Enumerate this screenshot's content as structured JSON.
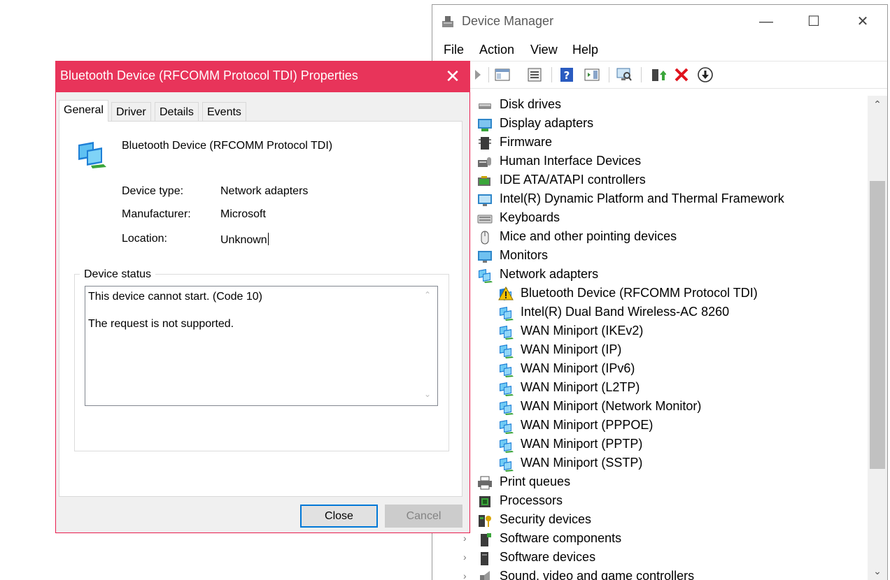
{
  "device_manager": {
    "title": "Device Manager",
    "window_buttons": {
      "minimize": "—",
      "maximize": "☐",
      "close": "✕"
    },
    "menu": [
      "File",
      "Action",
      "View",
      "Help"
    ],
    "toolbar": [
      "back-icon",
      "show-hide-console-tree-icon",
      "properties-icon",
      "help-icon",
      "action-pane-icon",
      "scan-for-hardware-changes-icon",
      "update-driver-icon",
      "uninstall-device-icon",
      "disable-device-icon"
    ],
    "tree": [
      {
        "label": "Disk drives",
        "icon": "disk-drive-icon",
        "level": 0
      },
      {
        "label": "Display adapters",
        "icon": "display-adapter-icon",
        "level": 0
      },
      {
        "label": "Firmware",
        "icon": "firmware-icon",
        "level": 0
      },
      {
        "label": "Human Interface Devices",
        "icon": "hid-icon",
        "level": 0
      },
      {
        "label": "IDE ATA/ATAPI controllers",
        "icon": "ide-controller-icon",
        "level": 0
      },
      {
        "label": "Intel(R) Dynamic Platform and Thermal Framework",
        "icon": "intel-platform-icon",
        "level": 0
      },
      {
        "label": "Keyboards",
        "icon": "keyboard-icon",
        "level": 0
      },
      {
        "label": "Mice and other pointing devices",
        "icon": "mouse-icon",
        "level": 0
      },
      {
        "label": "Monitors",
        "icon": "monitor-icon",
        "level": 0
      },
      {
        "label": "Network adapters",
        "icon": "network-adapter-icon",
        "level": 0
      },
      {
        "label": "Bluetooth Device (RFCOMM Protocol TDI)",
        "icon": "network-warning-icon",
        "level": 1
      },
      {
        "label": "Intel(R) Dual Band Wireless-AC 8260",
        "icon": "network-adapter-icon",
        "level": 1
      },
      {
        "label": "WAN Miniport (IKEv2)",
        "icon": "network-adapter-icon",
        "level": 1
      },
      {
        "label": "WAN Miniport (IP)",
        "icon": "network-adapter-icon",
        "level": 1
      },
      {
        "label": "WAN Miniport (IPv6)",
        "icon": "network-adapter-icon",
        "level": 1
      },
      {
        "label": "WAN Miniport (L2TP)",
        "icon": "network-adapter-icon",
        "level": 1
      },
      {
        "label": "WAN Miniport (Network Monitor)",
        "icon": "network-adapter-icon",
        "level": 1
      },
      {
        "label": "WAN Miniport (PPPOE)",
        "icon": "network-adapter-icon",
        "level": 1
      },
      {
        "label": "WAN Miniport (PPTP)",
        "icon": "network-adapter-icon",
        "level": 1
      },
      {
        "label": "WAN Miniport (SSTP)",
        "icon": "network-adapter-icon",
        "level": 1
      },
      {
        "label": "Print queues",
        "icon": "printer-icon",
        "level": 0
      },
      {
        "label": "Processors",
        "icon": "processor-icon",
        "level": 0
      },
      {
        "label": "Security devices",
        "icon": "security-device-icon",
        "level": 0
      },
      {
        "label": "Software components",
        "icon": "software-component-icon",
        "level": 0,
        "expander": "›"
      },
      {
        "label": "Software devices",
        "icon": "software-device-icon",
        "level": 0,
        "expander": "›"
      },
      {
        "label": "Sound, video and game controllers",
        "icon": "sound-icon",
        "level": 0,
        "expander": "›"
      }
    ],
    "scroll": {
      "up": "⌃",
      "down": "⌄"
    }
  },
  "dialog": {
    "title": "Bluetooth Device (RFCOMM Protocol TDI) Properties",
    "close_glyph": "✕",
    "tabs": [
      "General",
      "Driver",
      "Details",
      "Events"
    ],
    "active_tab": "General",
    "device_name": "Bluetooth Device (RFCOMM Protocol TDI)",
    "properties": {
      "device_type_label": "Device type:",
      "device_type_value": "Network adapters",
      "manufacturer_label": "Manufacturer:",
      "manufacturer_value": "Microsoft",
      "location_label": "Location:",
      "location_value": "Unknown"
    },
    "status": {
      "legend": "Device status",
      "line1": "This device cannot start. (Code 10)",
      "line2": "The request is not supported.",
      "scroll_up": "⌃",
      "scroll_down": "⌄"
    },
    "buttons": {
      "close": "Close",
      "cancel": "Cancel"
    }
  },
  "colors": {
    "dialog_titlebar": "#e8345a",
    "focus_blue": "#0078d7",
    "warning_yellow": "#f2c200"
  }
}
